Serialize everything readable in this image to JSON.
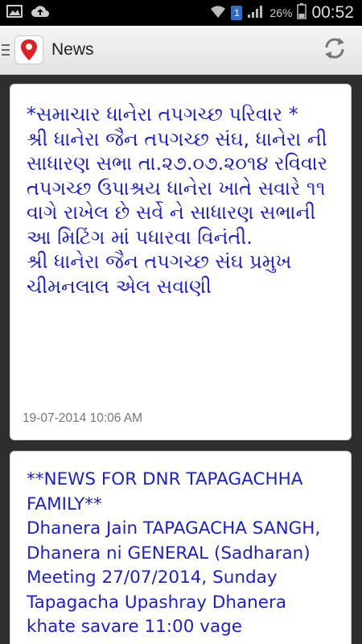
{
  "status_bar": {
    "sim": "1",
    "battery": "26%",
    "time": "00:52"
  },
  "action_bar": {
    "title": "News"
  },
  "news": [
    {
      "lines": [
        "*સમાચાર ધાનેરા તપગચ્છ પરિવાર *",
        "શ્રી ધાનેરા જૈન તપગચ્છ સંઘ, ધાનેરા ની સાધારણ સભા તા.૨૭.૦૭.૨૦૧૪ રવિવાર તપગચ્છ ઉપાશ્રય ધાનેરા ખાતે સવારે ૧૧ વાગે રાખેલ છે સર્વે ને સાધારણ સભાની આ મિટિંગ માં પધારવા વિનંતી.",
        "શ્રી ધાનેરા જૈન તપગચ્છ સંઘ પ્રમુખ",
        "ચીમનલાલ એલ સવાણી"
      ],
      "timestamp": "19-07-2014 10:06 AM"
    },
    {
      "lines": [
        "**NEWS FOR DNR TAPAGACHHA FAMILY**",
        "Dhanera Jain TAPAGACHA SANGH, Dhanera ni GENERAL (Sadharan) Meeting 27/07/2014, Sunday Tapagacha Upashray Dhanera khate savare 11:00 vage"
      ]
    }
  ]
}
